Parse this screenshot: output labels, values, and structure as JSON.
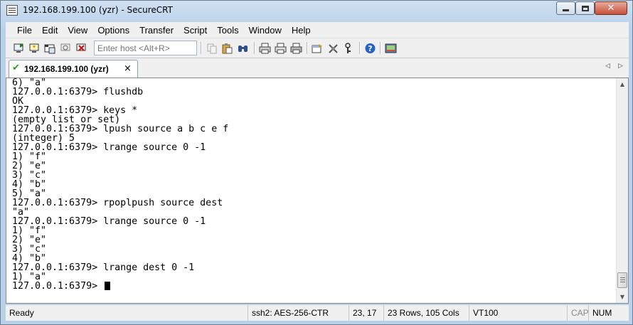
{
  "window": {
    "title": "192.168.199.100 (yzr) - SecureCRT",
    "close_glyph": "✕"
  },
  "menu": [
    "File",
    "Edit",
    "View",
    "Options",
    "Transfer",
    "Script",
    "Tools",
    "Window",
    "Help"
  ],
  "toolbar": {
    "quick_connect_placeholder": "Enter host <Alt+R>",
    "icons": [
      "connect-icon",
      "quick-connect-icon",
      "connect-in-tab-icon",
      "reconnect-icon",
      "disconnect-icon",
      "copy-icon",
      "paste-icon",
      "find-icon",
      "print-icon",
      "print-selection-icon",
      "print-setup-icon",
      "session-options-icon",
      "global-options-icon",
      "keymap-icon",
      "help-icon",
      "about-icon"
    ]
  },
  "tabs": [
    {
      "label": "192.168.199.100 (yzr)",
      "status": "connected",
      "close": "×"
    }
  ],
  "tab_scroll": {
    "left": "◁",
    "right": "▷"
  },
  "terminal": {
    "lines": [
      "6) \"a\"",
      "127.0.0.1:6379> flushdb",
      "OK",
      "127.0.0.1:6379> keys *",
      "(empty list or set)",
      "127.0.0.1:6379> lpush source a b c e f",
      "(integer) 5",
      "127.0.0.1:6379> lrange source 0 -1",
      "1) \"f\"",
      "2) \"e\"",
      "3) \"c\"",
      "4) \"b\"",
      "5) \"a\"",
      "127.0.0.1:6379> rpoplpush source dest",
      "\"a\"",
      "127.0.0.1:6379> lrange source 0 -1",
      "1) \"f\"",
      "2) \"e\"",
      "3) \"c\"",
      "4) \"b\"",
      "127.0.0.1:6379> lrange dest 0 -1",
      "1) \"a\""
    ],
    "prompt": "127.0.0.1:6379> "
  },
  "statusbar": {
    "status": "Ready",
    "protocol": "ssh2: AES-256-CTR",
    "cursor_pos": "23,  17",
    "dimensions": "23 Rows, 105 Cols",
    "emulation": "VT100",
    "caps": "CAP",
    "num": "NUM"
  },
  "colors": {
    "frame": "#b9d1ea",
    "terminal_bg": "#ffffff",
    "terminal_fg": "#000000",
    "tab_status": "#2aa22a"
  }
}
